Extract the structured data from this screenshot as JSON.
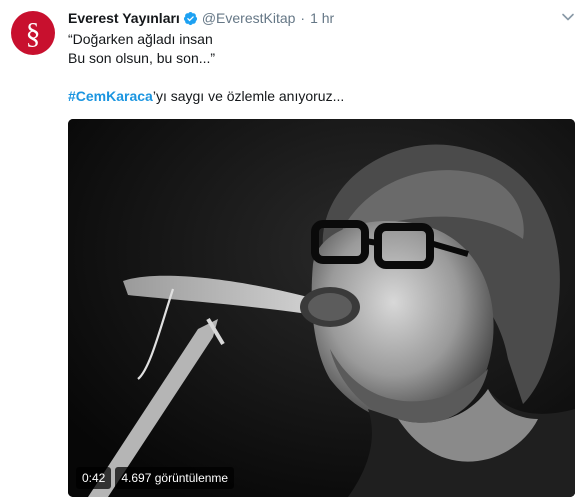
{
  "author": {
    "display_name": "Everest Yayınları",
    "handle": "@EverestKitap",
    "separator": "·",
    "time": "1 hr",
    "avatar_glyph": "§",
    "avatar_color": "#c8102e",
    "verified_icon": "verified-badge-icon"
  },
  "tweet": {
    "line1": "“Doğarken ağladı insan",
    "line2": "Bu son olsun, bu son...”",
    "hashtag": "#CemKaraca",
    "after_hashtag": "’yı saygı ve özlemle anıyoruz...",
    "link_color": "#1b95e0"
  },
  "video": {
    "duration": "0:42",
    "views": "4.697 görüntülenme"
  }
}
